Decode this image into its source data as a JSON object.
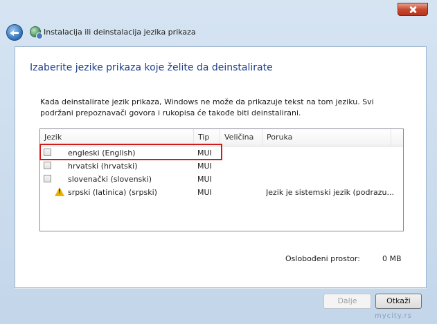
{
  "window": {
    "title": "Instalacija ili deinstalacija jezika prikaza"
  },
  "page": {
    "heading": "Izaberite jezike prikaza koje želite da deinstalirate",
    "description": "Kada deinstalirate jezik prikaza, Windows ne može da prikazuje tekst na tom jeziku. Svi podržani prepoznavači govora i rukopisa će takođe biti deinstalirani."
  },
  "table": {
    "columns": [
      "Jezik",
      "Tip",
      "Veličina",
      "Poruka"
    ],
    "rows": [
      {
        "language": "engleski (English)",
        "type": "MUI",
        "size": "",
        "message": "",
        "checked": false,
        "warning": false
      },
      {
        "language": "hrvatski (hrvatski)",
        "type": "MUI",
        "size": "",
        "message": "",
        "checked": false,
        "warning": false
      },
      {
        "language": "slovenački (slovenski)",
        "type": "MUI",
        "size": "",
        "message": "",
        "checked": false,
        "warning": false
      },
      {
        "language": "srpski (latinica) (srpski)",
        "type": "MUI",
        "size": "",
        "message": "Jezik je sistemski jezik (podrazu...",
        "checked": false,
        "warning": true
      }
    ]
  },
  "footer": {
    "space_label": "Oslobođeni prostor:",
    "space_value": "0 MB",
    "next_button": "Dalje",
    "cancel_button": "Otkaži"
  },
  "watermark": "mycity.rs",
  "colors": {
    "heading": "#1e3f8e",
    "highlight_border": "#d11b1b",
    "close_button": "#c74a31"
  },
  "icons": [
    "close-icon",
    "back-arrow-icon",
    "language-globe-icon",
    "warning-icon",
    "checkbox-icon"
  ]
}
